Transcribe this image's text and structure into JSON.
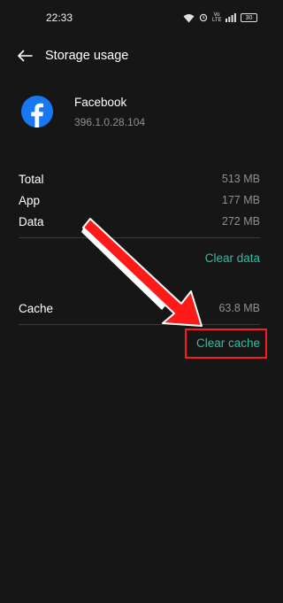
{
  "status_bar": {
    "time": "22:33",
    "signal_text": "Vo LTE",
    "battery": "30"
  },
  "header": {
    "title": "Storage usage"
  },
  "app": {
    "name": "Facebook",
    "version": "396.1.0.28.104",
    "icon": "facebook-icon",
    "icon_color": "#1877f2"
  },
  "storage": {
    "total_label": "Total",
    "total_value": "513 MB",
    "app_label": "App",
    "app_value": "177 MB",
    "data_label": "Data",
    "data_value": "272 MB",
    "clear_data_label": "Clear data",
    "cache_label": "Cache",
    "cache_value": "63.8 MB",
    "clear_cache_label": "Clear cache"
  },
  "colors": {
    "background": "#161616",
    "accent": "#2fbfa8",
    "annotation": "#ff1a1a"
  }
}
